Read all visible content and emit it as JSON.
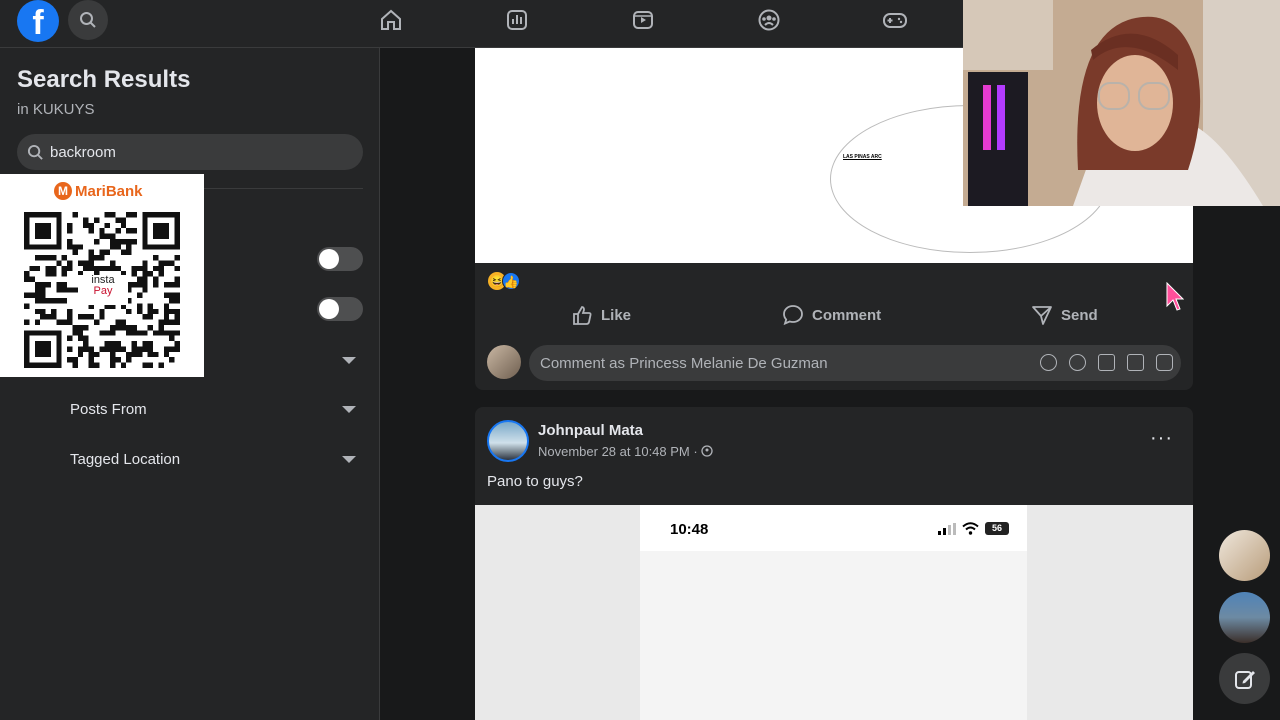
{
  "sidebar": {
    "title": "Search Results",
    "subtitle": "in KUKUYS",
    "search_value": "backroom",
    "filters": {
      "posts_from": "Posts From",
      "tagged_location": "Tagged Location"
    }
  },
  "qr_overlay": {
    "brand": "MariBank",
    "brand_letter": "M",
    "insta_line1": "insta",
    "insta_line2": "Pay"
  },
  "post1": {
    "image_text": "LAS PINAS ARC",
    "reaction_haha": "😆",
    "reaction_like": "👍",
    "actions": {
      "like": "Like",
      "comment": "Comment",
      "send": "Send"
    },
    "comment_placeholder": "Comment as Princess Melanie De Guzman",
    "comment_tools": [
      "avatar-sticker",
      "emoji",
      "camera",
      "GIF",
      "sticker"
    ]
  },
  "post2": {
    "author": "Johnpaul Mata",
    "timestamp": "November 28 at 10:48 PM · ",
    "more": "···",
    "text": "Pano to guys?",
    "phone_time": "10:48",
    "battery": "56"
  },
  "colors": {
    "facebook_blue": "#1877f2",
    "maribank_orange": "#e8661c",
    "cursor_pink": "#ff4f9a"
  }
}
